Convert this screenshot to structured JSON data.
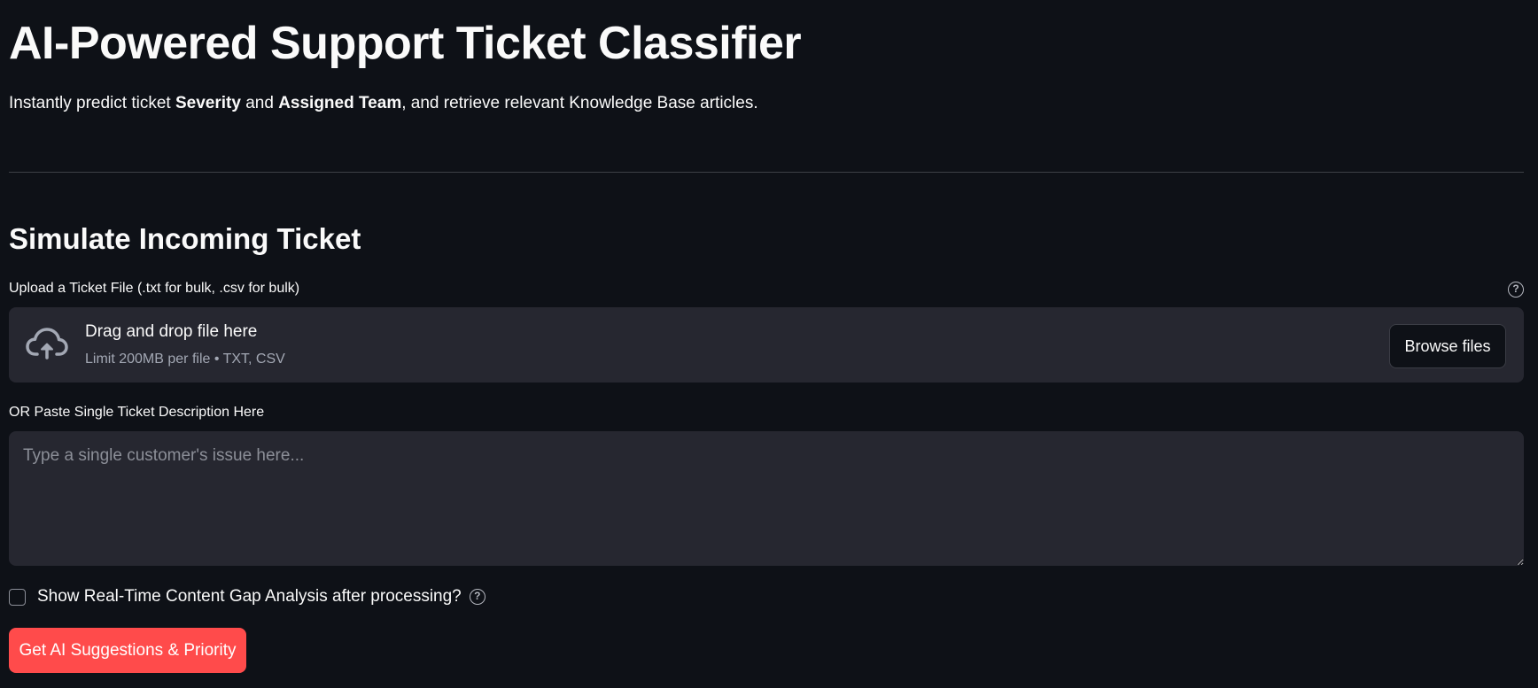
{
  "header": {
    "title": "AI-Powered Support Ticket Classifier",
    "subtitle_parts": {
      "p1": "Instantly predict ticket ",
      "b1": "Severity",
      "p2": " and ",
      "b2": "Assigned Team",
      "p3": ", and retrieve relevant Knowledge Base articles."
    }
  },
  "section": {
    "title": "Simulate Incoming Ticket"
  },
  "upload": {
    "label": "Upload a Ticket File (.txt for bulk, .csv for bulk)",
    "help_icon": "question-circle-icon",
    "drop_title": "Drag and drop file here",
    "limit_text": "Limit 200MB per file • TXT, CSV",
    "browse_label": "Browse files",
    "icon": "cloud-upload-icon"
  },
  "paste": {
    "label": "OR Paste Single Ticket Description Here",
    "placeholder": "Type a single customer's issue here...",
    "value": ""
  },
  "gap_analysis": {
    "label": "Show Real-Time Content Gap Analysis after processing?",
    "checked": false,
    "help_icon": "question-circle-icon"
  },
  "submit": {
    "label": "Get AI Suggestions & Priority"
  },
  "colors": {
    "background": "#0e1117",
    "surface": "#262730",
    "primary": "#ff4b4b",
    "text": "#fafafa",
    "muted": "#a3a8b4"
  }
}
